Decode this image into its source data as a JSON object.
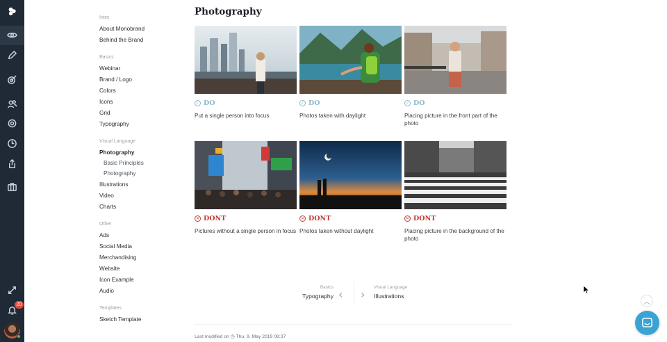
{
  "nav": {
    "groups": [
      {
        "label": "Intro",
        "items": [
          {
            "label": "About Monobrand"
          },
          {
            "label": "Behind the Brand"
          }
        ]
      },
      {
        "label": "Basics",
        "items": [
          {
            "label": "Webinar"
          },
          {
            "label": "Brand / Logo"
          },
          {
            "label": "Colors"
          },
          {
            "label": "Icons"
          },
          {
            "label": "Grid"
          },
          {
            "label": "Typography"
          }
        ]
      },
      {
        "label": "Visual Language",
        "items": [
          {
            "label": "Photography",
            "current": true
          },
          {
            "label": "Basic Principles",
            "sub": true
          },
          {
            "label": "Photography",
            "sub": true
          },
          {
            "label": "Illustrations"
          },
          {
            "label": "Video"
          },
          {
            "label": "Charts"
          }
        ]
      },
      {
        "label": "Other",
        "items": [
          {
            "label": "Ads"
          },
          {
            "label": "Social Media"
          },
          {
            "label": "Merchandising"
          },
          {
            "label": "Website"
          },
          {
            "label": "Icon Example"
          },
          {
            "label": "Audio"
          }
        ]
      },
      {
        "label": "Templates",
        "items": [
          {
            "label": "Sketch Template"
          }
        ]
      }
    ]
  },
  "rail": {
    "icons": [
      "logo-icon",
      "eye-icon",
      "pencil-icon",
      "target-icon",
      "users-icon",
      "gear-icon",
      "clock-icon",
      "share-icon",
      "briefcase-icon",
      "expand-icon",
      "bell-icon"
    ],
    "notification_count": "20"
  },
  "page": {
    "title": "Photography"
  },
  "cards": [
    {
      "verdict": "DO",
      "type": "do",
      "caption": "Put a single person into focus",
      "photo": "city-person"
    },
    {
      "verdict": "DO",
      "type": "do",
      "caption": "Photos taken with daylight",
      "photo": "lake-hiker"
    },
    {
      "verdict": "DO",
      "type": "do",
      "caption": "Placing picture in the front part of the photo",
      "photo": "street-photographer"
    },
    {
      "verdict": "DONT",
      "type": "dont",
      "caption": "Pictures without a single person in focus",
      "photo": "crowded-street"
    },
    {
      "verdict": "DONT",
      "type": "dont",
      "caption": "Photos taken without daylight",
      "photo": "sunset-couple"
    },
    {
      "verdict": "DONT",
      "type": "dont",
      "caption": "Placing picture in the background of the photo",
      "photo": "crosswalk"
    }
  ],
  "pager": {
    "prev_section": "Basics",
    "prev_title": "Typography",
    "next_section": "Visual Language",
    "next_title": "Illustrations"
  },
  "footer": {
    "modified_label": "Last modified on",
    "modified_date": "Thu, 9. May 2019 08:37"
  },
  "colors": {
    "rail": "#1f2a36",
    "do": "#8bb8cc",
    "dont": "#c23a30",
    "chat": "#3aa3d3"
  }
}
